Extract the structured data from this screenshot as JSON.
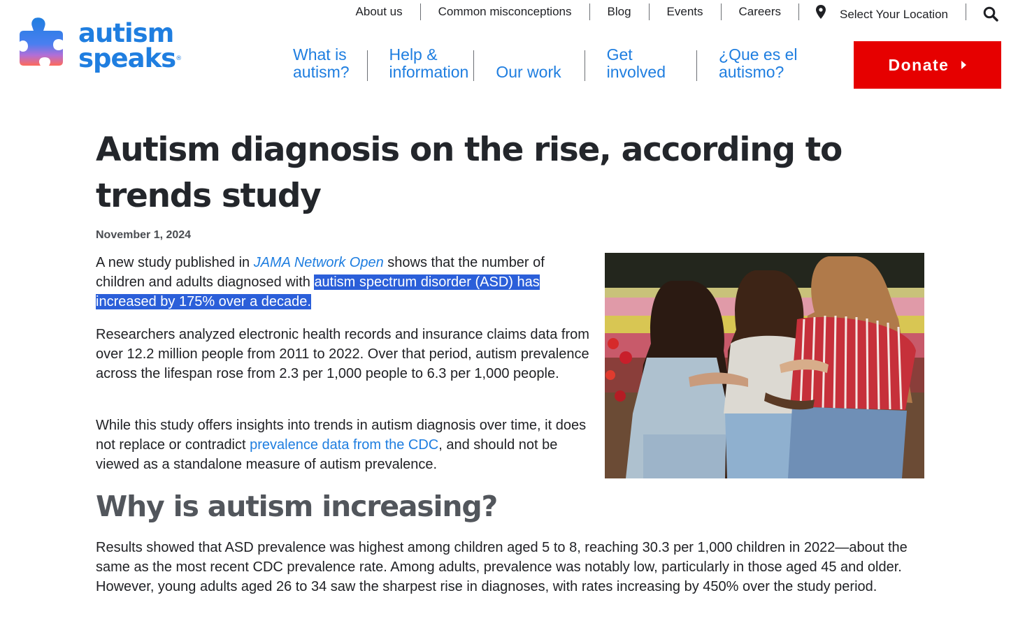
{
  "brand": {
    "name_line1": "autism",
    "name_line2": "speaks",
    "registered": "®",
    "logo_icon": "puzzle-piece-icon",
    "color": "#1f7ee0"
  },
  "utility_nav": {
    "items": [
      "About us",
      "Common misconceptions",
      "Blog",
      "Events",
      "Careers"
    ],
    "location_label": "Select Your Location",
    "location_icon": "map-pin-icon",
    "search_icon": "search-icon"
  },
  "main_nav": {
    "items": [
      {
        "line1": "What is",
        "line2": "autism?"
      },
      {
        "line1": "Help &",
        "line2": "information"
      },
      {
        "line1": "",
        "line2": "Our work"
      },
      {
        "line1": "Get",
        "line2": "involved"
      },
      {
        "line1": "¿Que es el",
        "line2": "autismo?"
      }
    ],
    "donate_label": "Donate",
    "donate_color": "#e60000"
  },
  "article": {
    "title": "Autism diagnosis on the rise, according to trends study",
    "date": "November 1, 2024",
    "p1": {
      "before": "A new study published in ",
      "link": "JAMA Network Open",
      "middle": " shows that the number of children and adults diagnosed with ",
      "highlight": "autism spectrum disorder (ASD) has increased by 175% over a decade."
    },
    "p2": "Researchers analyzed electronic health records and insurance claims data from over 12.2 million people from 2011 to 2022. Over that period, autism prevalence across the lifespan rose from 2.3 per 1,000 people to 6.3 per 1,000 people.",
    "p3": {
      "before": "While this study offers insights into trends in autism diagnosis over time, it does not replace or contradict ",
      "link": "prevalence data from the CDC",
      "after": ", and should not be viewed as a standalone measure of autism prevalence."
    },
    "subheading": "Why is autism increasing?",
    "p4": "Results showed that ASD prevalence was highest among children aged 5 to 8, reaching 30.3 per 1,000 children in 2022—about the same as the most recent CDC prevalence rate. Among adults, prevalence was notably low, particularly in those aged 45 and older. However, young adults aged 26 to 34 saw the sharpest rise in diagnoses, with rates increasing by 450% over the study period.",
    "image_icon": "three-women-flower-field-photo",
    "highlight_color": "#2b5fd9"
  }
}
